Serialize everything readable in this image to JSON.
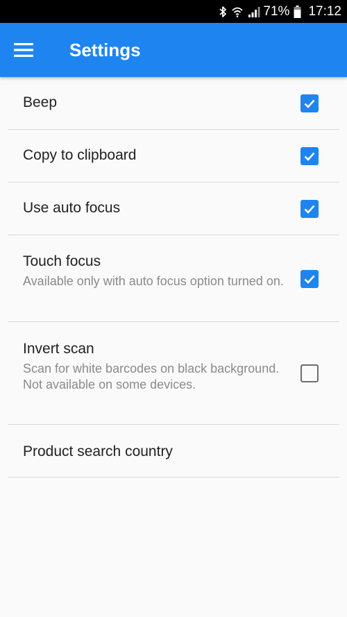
{
  "status_bar": {
    "icons": [
      "bluetooth-icon",
      "wifi-icon",
      "signal-icon",
      "battery-icon"
    ],
    "battery_percent": "71%",
    "time": "17:12"
  },
  "app_bar": {
    "title": "Settings",
    "menu_icon": "hamburger-menu-icon",
    "color": "#1e85f0"
  },
  "settings": [
    {
      "title": "Beep",
      "summary": "",
      "checked": true
    },
    {
      "title": "Copy to clipboard",
      "summary": "",
      "checked": true
    },
    {
      "title": "Use auto focus",
      "summary": "",
      "checked": true
    },
    {
      "title": "Touch focus",
      "summary": "Available only with auto focus option turned on.",
      "checked": true
    },
    {
      "title": "Invert scan",
      "summary": "Scan for white barcodes on black background. Not available on some devices.",
      "checked": false
    },
    {
      "title": "Product search country",
      "summary": ""
    }
  ]
}
